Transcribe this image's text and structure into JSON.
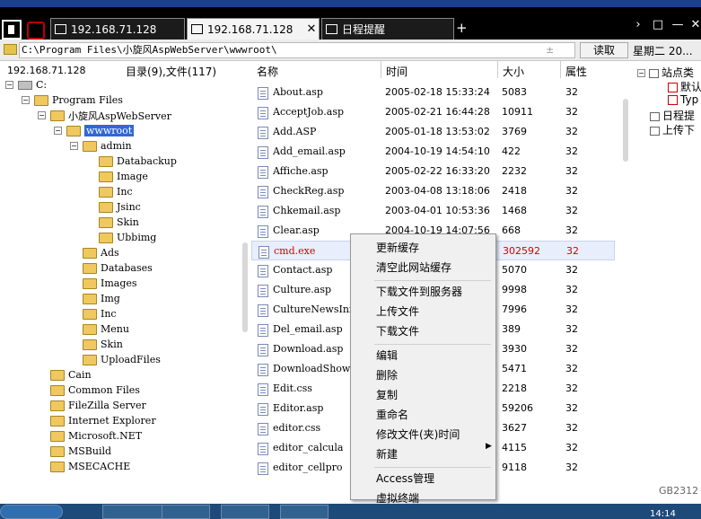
{
  "tabs": [
    {
      "label": "192.168.71.128",
      "active": false
    },
    {
      "label": "192.168.71.128",
      "active": true
    },
    {
      "label": "日程提醒",
      "active": false
    }
  ],
  "address": {
    "path": "C:\\Program Files\\小旋风AspWebServer\\wwwroot\\",
    "extra": "±",
    "read_button": "读取",
    "date": "星期二 20..."
  },
  "status": {
    "ip": "192.168.71.128",
    "dir_count": "目录(9),文件(117)"
  },
  "tree": [
    {
      "label": "C:",
      "indent": 0,
      "kind": "drive",
      "exp": "−"
    },
    {
      "label": "Program Files",
      "indent": 1,
      "kind": "folder",
      "exp": "−"
    },
    {
      "label": "小旋风AspWebServer",
      "indent": 2,
      "kind": "folder",
      "exp": "−"
    },
    {
      "label": "wwwroot",
      "indent": 3,
      "kind": "folder",
      "exp": "−",
      "selected": true
    },
    {
      "label": "admin",
      "indent": 4,
      "kind": "folder",
      "exp": "−"
    },
    {
      "label": "Databackup",
      "indent": 5,
      "kind": "folder"
    },
    {
      "label": "Image",
      "indent": 5,
      "kind": "folder"
    },
    {
      "label": "Inc",
      "indent": 5,
      "kind": "folder"
    },
    {
      "label": "Jsinc",
      "indent": 5,
      "kind": "folder"
    },
    {
      "label": "Skin",
      "indent": 5,
      "kind": "folder"
    },
    {
      "label": "Ubbimg",
      "indent": 5,
      "kind": "folder"
    },
    {
      "label": "Ads",
      "indent": 4,
      "kind": "folder"
    },
    {
      "label": "Databases",
      "indent": 4,
      "kind": "folder"
    },
    {
      "label": "Images",
      "indent": 4,
      "kind": "folder"
    },
    {
      "label": "Img",
      "indent": 4,
      "kind": "folder"
    },
    {
      "label": "Inc",
      "indent": 4,
      "kind": "folder"
    },
    {
      "label": "Menu",
      "indent": 4,
      "kind": "folder"
    },
    {
      "label": "Skin",
      "indent": 4,
      "kind": "folder"
    },
    {
      "label": "UploadFiles",
      "indent": 4,
      "kind": "folder"
    },
    {
      "label": "Cain",
      "indent": 2,
      "kind": "folder"
    },
    {
      "label": "Common Files",
      "indent": 2,
      "kind": "folder"
    },
    {
      "label": "FileZilla Server",
      "indent": 2,
      "kind": "folder"
    },
    {
      "label": "Internet Explorer",
      "indent": 2,
      "kind": "folder"
    },
    {
      "label": "Microsoft.NET",
      "indent": 2,
      "kind": "folder"
    },
    {
      "label": "MSBuild",
      "indent": 2,
      "kind": "folder"
    },
    {
      "label": "MSECACHE",
      "indent": 2,
      "kind": "folder"
    }
  ],
  "filelist": {
    "headers": {
      "name": "名称",
      "time": "时间",
      "size": "大小",
      "attr": "属性"
    },
    "rows": [
      {
        "name": "About.asp",
        "time": "2005-02-18 15:33:24",
        "size": "5083",
        "attr": "32"
      },
      {
        "name": "AcceptJob.asp",
        "time": "2005-02-21 16:44:28",
        "size": "10911",
        "attr": "32"
      },
      {
        "name": "Add.ASP",
        "time": "2005-01-18 13:53:02",
        "size": "3769",
        "attr": "32"
      },
      {
        "name": "Add_email.asp",
        "time": "2004-10-19 14:54:10",
        "size": "422",
        "attr": "32"
      },
      {
        "name": "Affiche.asp",
        "time": "2005-02-22 16:33:20",
        "size": "2232",
        "attr": "32"
      },
      {
        "name": "CheckReg.asp",
        "time": "2003-04-08 13:18:06",
        "size": "2418",
        "attr": "32"
      },
      {
        "name": "Chkemail.asp",
        "time": "2003-04-01 10:53:36",
        "size": "1468",
        "attr": "32"
      },
      {
        "name": "Clear.asp",
        "time": "2004-10-19 14:07:56",
        "size": "668",
        "attr": "32"
      },
      {
        "name": "cmd.exe",
        "time": "",
        "size": "302592",
        "attr": "32",
        "highlight": true
      },
      {
        "name": "Contact.asp",
        "time": "",
        "size": "5070",
        "attr": "32"
      },
      {
        "name": "Culture.asp",
        "time": "",
        "size": "9998",
        "attr": "32"
      },
      {
        "name": "CultureNewsInf",
        "time": "",
        "size": "7996",
        "attr": "32"
      },
      {
        "name": "Del_email.asp",
        "time": "",
        "size": "389",
        "attr": "32"
      },
      {
        "name": "Download.asp",
        "time": "",
        "size": "3930",
        "attr": "32"
      },
      {
        "name": "DownloadShow.a",
        "time": "",
        "size": "5471",
        "attr": "32"
      },
      {
        "name": "Edit.css",
        "time": "",
        "size": "2218",
        "attr": "32"
      },
      {
        "name": "Editor.asp",
        "time": "",
        "size": "59206",
        "attr": "32"
      },
      {
        "name": "editor.css",
        "time": "",
        "size": "3627",
        "attr": "32"
      },
      {
        "name": "editor_calcula",
        "time": "",
        "size": "4115",
        "attr": "32"
      },
      {
        "name": "editor_cellpro",
        "time": "",
        "size": "9118",
        "attr": "32"
      }
    ]
  },
  "context_menu": {
    "groups": [
      [
        "更新缓存",
        "清空此网站缓存"
      ],
      [
        "下载文件到服务器",
        "上传文件",
        "下载文件"
      ],
      [
        "编辑",
        "删除",
        "复制",
        "重命名",
        "修改文件(夹)时间",
        "新建"
      ],
      [
        "Access管理",
        "虚拟终端"
      ]
    ]
  },
  "right_panel": {
    "root": "站点类",
    "children": [
      "默认",
      "Typ"
    ],
    "schedule": "日程提",
    "upload": "上传下",
    "footer": "GB2312"
  },
  "taskbar": {
    "clock": "14:14"
  }
}
